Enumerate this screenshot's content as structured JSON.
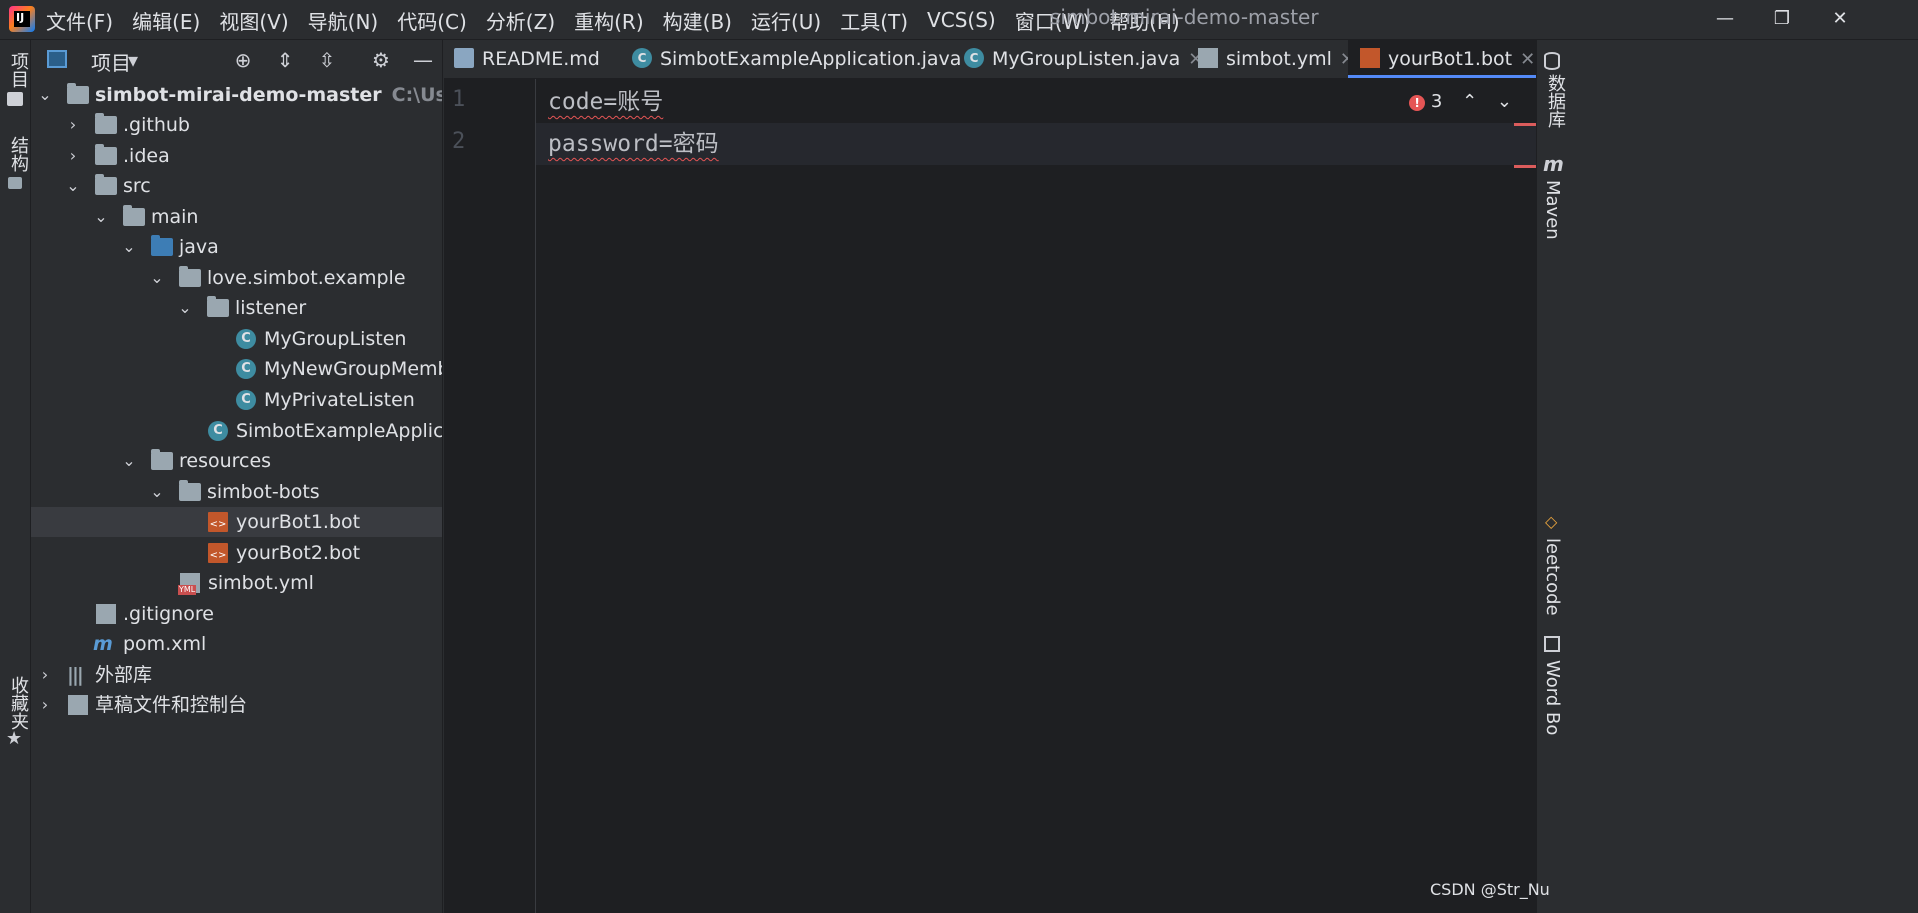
{
  "menubar": {
    "items": [
      "文件(F)",
      "编辑(E)",
      "视图(V)",
      "导航(N)",
      "代码(C)",
      "分析(Z)",
      "重构(R)",
      "构建(B)",
      "运行(U)",
      "工具(T)",
      "VCS(S)",
      "窗口(W)",
      "帮助(H)"
    ],
    "window_title": "simbot-mirai-demo-master"
  },
  "left_stripe": {
    "project_label": "项目",
    "structure_label": "结构",
    "favorites_label": "收藏夹"
  },
  "project_panel": {
    "title": "项目",
    "tree": [
      {
        "label": "simbot-mirai-demo-master",
        "hint": "C:\\Users\\hp\\",
        "expanded": true,
        "icon": "folder"
      },
      {
        "label": ".github",
        "icon": "folder"
      },
      {
        "label": ".idea",
        "icon": "folder"
      },
      {
        "label": "src",
        "icon": "folder"
      },
      {
        "label": "main",
        "icon": "folder"
      },
      {
        "label": "java",
        "icon": "source-folder"
      },
      {
        "label": "love.simbot.example",
        "icon": "package"
      },
      {
        "label": "listener",
        "icon": "package"
      },
      {
        "label": "MyGroupListen",
        "icon": "class"
      },
      {
        "label": "MyNewGroupMembe",
        "icon": "class"
      },
      {
        "label": "MyPrivateListen",
        "icon": "class"
      },
      {
        "label": "SimbotExampleApplicatio",
        "icon": "class"
      },
      {
        "label": "resources",
        "icon": "resources-folder"
      },
      {
        "label": "simbot-bots",
        "icon": "folder"
      },
      {
        "label": "yourBot1.bot",
        "icon": "bot-file"
      },
      {
        "label": "yourBot2.bot",
        "icon": "bot-file"
      },
      {
        "label": "simbot.yml",
        "icon": "yml-file"
      },
      {
        "label": ".gitignore",
        "icon": "ignore-file"
      },
      {
        "label": "pom.xml",
        "icon": "maven-file"
      },
      {
        "label": "外部库",
        "icon": "library"
      },
      {
        "label": "草稿文件和控制台",
        "icon": "scratch"
      }
    ]
  },
  "tabs": [
    {
      "label": "README.md",
      "icon": "md"
    },
    {
      "label": "SimbotExampleApplication.java",
      "icon": "class"
    },
    {
      "label": "MyGroupListen.java",
      "icon": "class"
    },
    {
      "label": "simbot.yml",
      "icon": "yml"
    },
    {
      "label": "yourBot1.bot",
      "icon": "bot",
      "active": true
    }
  ],
  "editor": {
    "lines": [
      "code=账号",
      "password=密码"
    ],
    "line_numbers": [
      "1",
      "2"
    ],
    "error_count": "3"
  },
  "right_stripe": {
    "database_label": "数据库",
    "maven_label": "Maven",
    "leetcode_label": "leetcode",
    "wordbook_label": "Word Bo"
  },
  "watermark": "CSDN @Str_Nu"
}
